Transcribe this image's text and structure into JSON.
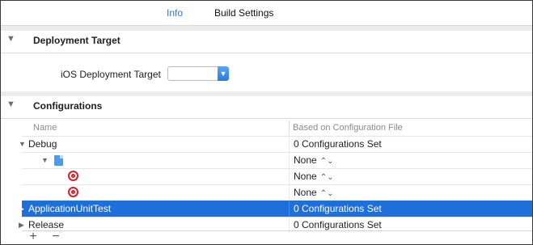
{
  "tabs": [
    {
      "label": "Info",
      "active": true
    },
    {
      "label": "Build Settings",
      "active": false
    }
  ],
  "deployment": {
    "header": "Deployment Target",
    "field_label": "iOS Deployment Target",
    "value": ""
  },
  "configurations": {
    "header": "Configurations",
    "columns": [
      "Name",
      "Based on Configuration File"
    ],
    "rows": [
      {
        "name": "Debug",
        "base": "0 Configurations Set",
        "expanded": true,
        "selected": false
      },
      {
        "name": "",
        "base": "None",
        "icon": "project-icon",
        "selected": false
      },
      {
        "name": "",
        "base": "None",
        "icon": "target-icon",
        "selected": false
      },
      {
        "name": "",
        "base": "None",
        "icon": "target-icon",
        "selected": false
      },
      {
        "name": "ApplicationUnitTest",
        "base": "0 Configurations Set",
        "expanded": false,
        "selected": true
      },
      {
        "name": "Release",
        "base": "0 Configurations Set",
        "expanded": false,
        "selected": false
      }
    ]
  },
  "footer": {
    "add": "+",
    "remove": "−"
  },
  "icons": {
    "disclosure_open": "▼",
    "disclosure_closed": "▶",
    "stepper": "⌃⌄"
  },
  "colors": {
    "accent": "#2b7bd6",
    "selection": "#1e6fd9",
    "target_red": "#d61e2b"
  }
}
